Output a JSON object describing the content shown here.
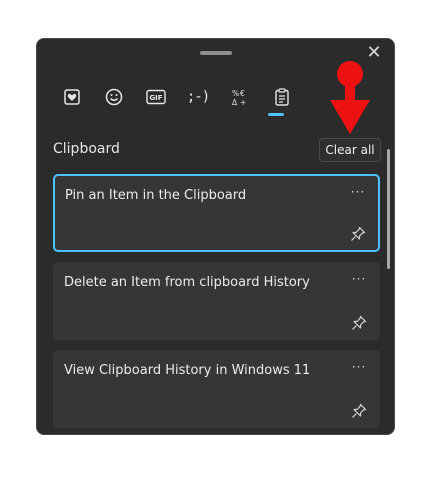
{
  "panel": {
    "tabs": [
      {
        "name": "kaomoji",
        "label": ";-)"
      }
    ],
    "section_title": "Clipboard",
    "clear_all_label": "Clear all",
    "items": [
      {
        "text": "Pin an Item in the Clipboard",
        "more": "···"
      },
      {
        "text": "Delete an Item from clipboard History",
        "more": "···"
      },
      {
        "text": "View Clipboard History in Windows 11",
        "more": "···"
      }
    ],
    "close_glyph": "✕"
  },
  "colors": {
    "panel_bg": "#2b2b2b",
    "item_bg": "#363636",
    "accent": "#4cc2ff",
    "annotation_arrow": "#ee1111"
  }
}
